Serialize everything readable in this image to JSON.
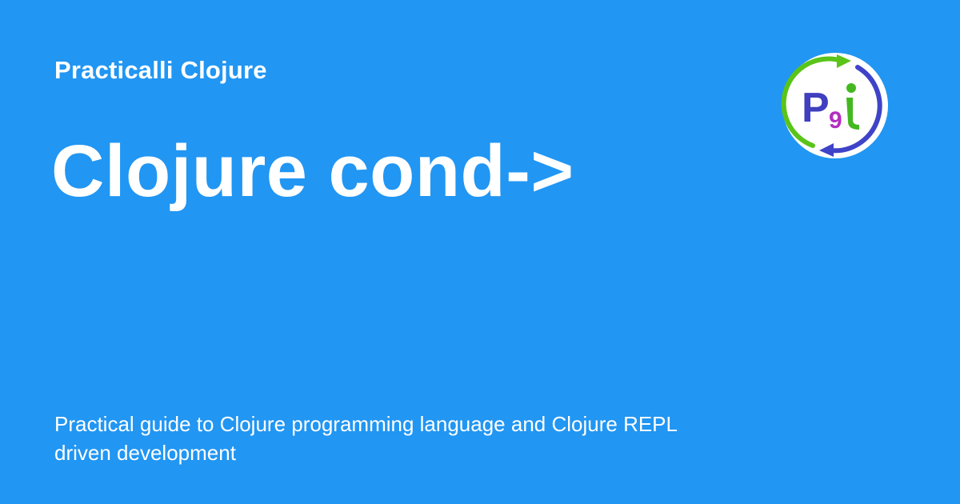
{
  "card": {
    "site_name": "Practicalli Clojure",
    "title": "Clojure cond->",
    "description": "Practical guide to Clojure programming language and Clojure REPL driven development"
  },
  "logo": {
    "icon": "practicalli-logo-icon",
    "letters": "P9i",
    "colors": {
      "background": "#ffffff",
      "arrow_green": "#5ac419",
      "arrow_blue": "#3f43c8",
      "letter_p": "#3f3fbf",
      "letter_9": "#b22ec0",
      "letter_i": "#43b820"
    }
  },
  "colors": {
    "background": "#2196f3",
    "text": "#ffffff"
  }
}
